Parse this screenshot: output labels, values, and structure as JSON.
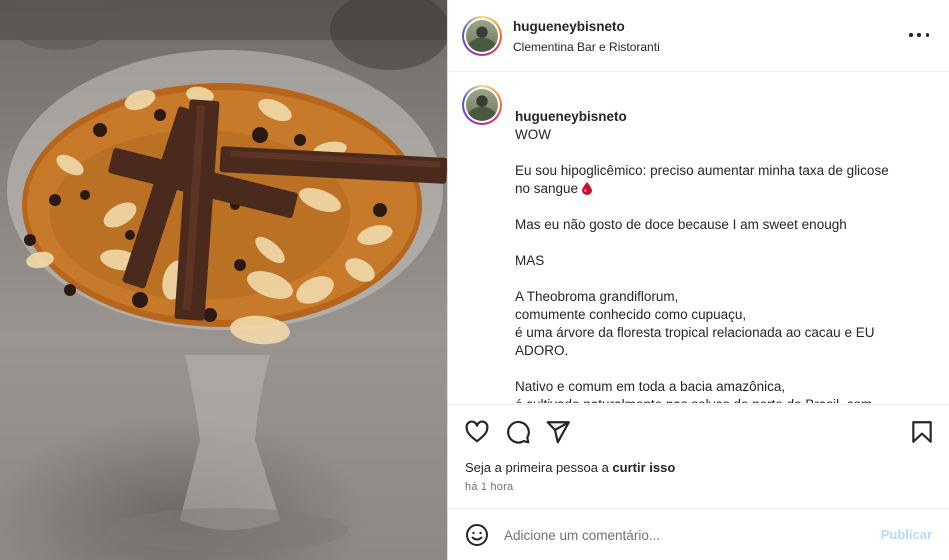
{
  "post": {
    "username": "hugueneybisneto",
    "location": "Clementina Bar e Ristoranti",
    "caption_first": "WOW",
    "caption_paragraphs": [
      "Eu sou hipoglicêmico: preciso aumentar minha taxa de glicose\nno sangue",
      "Mas eu não gosto de doce because I am sweet enough",
      "MAS",
      "A Theobroma grandiflorum,\ncomumente conhecido como cupuaçu,\né uma árvore da floresta tropical relacionada ao cacau e EU\nADORO.",
      "Nativo e comum em toda a bacia amazônica,\né cultivado naturalmente nas selvas do norte do Brasil, com\nmaior produção no Pará, Amazonas e Amapá, Colômbia, e\ntambém na Bolívia e Peru."
    ],
    "likes_prefix": "Seja a primeira pessoa a ",
    "likes_link": "curtir isso",
    "time": "há 1 hora"
  },
  "comment": {
    "placeholder": "Adicione um comentário...",
    "publish_label": "Publicar"
  },
  "icons": {
    "more": "more-options-icon",
    "like": "heart-icon",
    "comment": "comment-bubble-icon",
    "share": "paper-plane-icon",
    "save": "bookmark-icon",
    "emoji": "smiley-icon"
  },
  "colors": {
    "publish_disabled": "#b3dbff",
    "secondary_text": "#737373",
    "blood_drop": "#c8102e"
  }
}
